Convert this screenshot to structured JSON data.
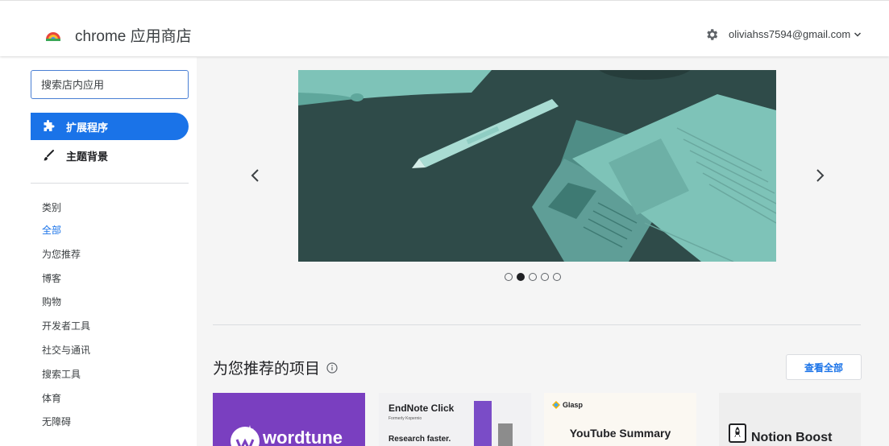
{
  "header": {
    "store_title": "chrome 应用商店",
    "account_email": "oliviahss7594@gmail.com",
    "icons": [
      "chrome-rainbow-logo-icon",
      "gear-icon",
      "chevron-down-icon"
    ]
  },
  "sidebar": {
    "search_placeholder": "搜索店内应用",
    "nav": [
      {
        "label": "扩展程序",
        "icon": "puzzle-icon",
        "active": true
      },
      {
        "label": "主题背景",
        "icon": "paintbrush-icon",
        "active": false
      }
    ],
    "categories_heading": "类别",
    "categories": [
      "全部",
      "为您推荐",
      "博客",
      "购物",
      "开发者工具",
      "社交与通讯",
      "搜索工具",
      "体育",
      "无障碍"
    ],
    "selected_category": "全部"
  },
  "carousel": {
    "dot_count": 5,
    "active_index": 1
  },
  "recommended": {
    "title": "为您推荐的项目",
    "view_all": "查看全部",
    "cards": [
      {
        "name": "wordtune"
      },
      {
        "name": "EndNote Click",
        "subtitle": "Formerly Kopernio",
        "tagline": "Research faster."
      },
      {
        "brand": "Glasp",
        "name": "YouTube Summary"
      },
      {
        "name": "Notion Boost"
      }
    ]
  },
  "colors": {
    "accent": "#1a73e8",
    "banner_bg": "#2f4b49",
    "banner_paper": "#7ec3b8"
  }
}
